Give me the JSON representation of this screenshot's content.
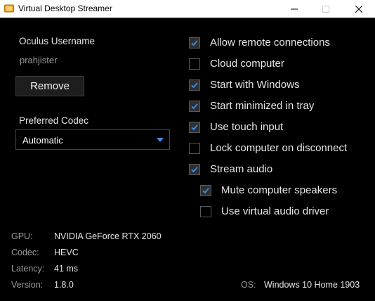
{
  "window": {
    "title": "Virtual Desktop Streamer"
  },
  "account": {
    "username_label": "Oculus Username",
    "username": "prahjister",
    "remove_label": "Remove"
  },
  "codec_select": {
    "label": "Preferred Codec",
    "value": "Automatic"
  },
  "options": [
    {
      "label": "Allow remote connections",
      "checked": true
    },
    {
      "label": "Cloud computer",
      "checked": false
    },
    {
      "label": "Start with Windows",
      "checked": true
    },
    {
      "label": "Start minimized in tray",
      "checked": true
    },
    {
      "label": "Use touch input",
      "checked": true
    },
    {
      "label": "Lock computer on disconnect",
      "checked": false
    },
    {
      "label": "Stream audio",
      "checked": true
    },
    {
      "label": "Mute computer speakers",
      "checked": true
    },
    {
      "label": "Use virtual audio driver",
      "checked": false
    }
  ],
  "info": {
    "gpu_label": "GPU:",
    "gpu": "NVIDIA GeForce RTX 2060",
    "codec_label": "Codec:",
    "codec": "HEVC",
    "latency_label": "Latency:",
    "latency": "41 ms",
    "version_label": "Version:",
    "version": "1.8.0",
    "os_label": "OS:",
    "os": "Windows 10 Home 1903"
  }
}
